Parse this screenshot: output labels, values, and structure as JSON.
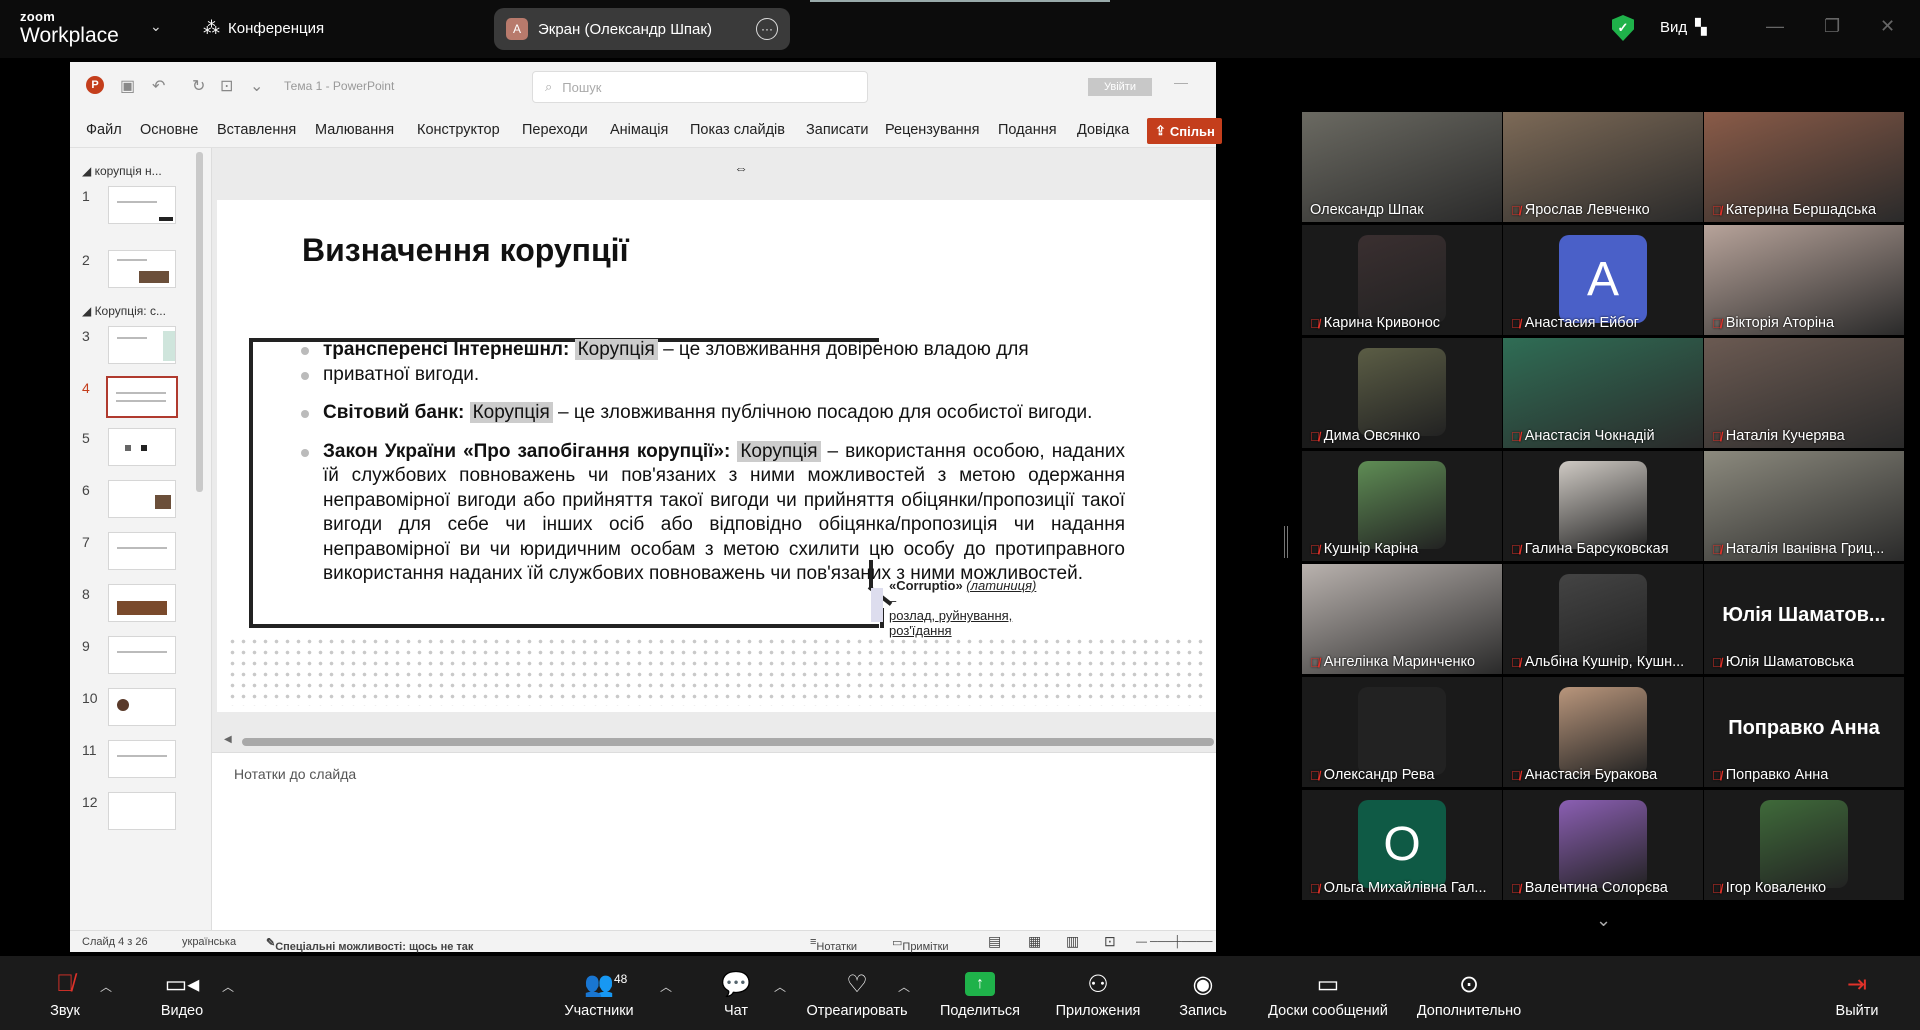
{
  "zoom": {
    "brand_top": "zoom",
    "brand_bottom": "Workplace",
    "meeting_label": "Конференция",
    "screen_share_label": "Экран (Олександр Шпак)",
    "screen_share_avatar": "A",
    "view_label": "Вид",
    "security_color": "#1fb24a"
  },
  "ppt": {
    "doc_title": "Тема 1 - PowerPoint",
    "search_placeholder": "Пошук",
    "signin_label": "Увійти",
    "tabs": [
      "Файл",
      "Основне",
      "Вставлення",
      "Малювання",
      "Конструктор",
      "Переходи",
      "Анімація",
      "Показ слайдів",
      "Записати",
      "Рецензування",
      "Подання",
      "Довідка"
    ],
    "share_label": "Спільн",
    "sections": [
      "корупція н...",
      "Корупція: с..."
    ],
    "slide_numbers": [
      "1",
      "2",
      "3",
      "4",
      "5",
      "6",
      "7",
      "8",
      "9",
      "10",
      "11",
      "12"
    ],
    "active_slide": "4",
    "notes_placeholder": "Нотатки до слайда",
    "status": {
      "slide_counter": "Слайд 4 з 26",
      "language": "українська",
      "accessibility": "Спеціальні можливості: щось не так",
      "notes": "Нотатки",
      "comments": "Примітки"
    },
    "accent": "#c43e1c"
  },
  "slide": {
    "title": "Визначення корупції",
    "b1_label": "трансперенсі Інтернешнл:",
    "b1_term": "Корупція",
    "b1_line1_rest": "– це зловживання довіреною владою для",
    "b1_line2": "приватної вигоди.",
    "b2_label": "Світовий банк:",
    "b2_term": "Корупція",
    "b2_rest": "– це зловживання публічною посадою для особистої вигоди.",
    "b3_label": "Закон України «Про запобігання корупції»:",
    "b3_term": "Корупція",
    "b3_rest": "– використання особою, наданих їй службових повноважень чи пов'язаних з ними можливостей з метою одержання неправомірної вигоди або прийняття такої вигоди чи прийняття обіцянки/пропозиції такої вигоди для себе чи інших осіб або відповідно обіцянка/пропозиція чи надання неправомірної ви чи юридичним особам з метою схилити цю особу до протиправного використання наданих їй службових повноважень чи пов'язаних з ними можливостей.",
    "callout_term": "«Corruptio»",
    "callout_lang": "(латиниця)",
    "callout_dash": "–",
    "callout_meaning": "розлад, руйнування, роз'їдання"
  },
  "participants": [
    {
      "name": "Олександр Шпак",
      "muted": false,
      "active": true,
      "kind": "video",
      "color": "#6b6a62"
    },
    {
      "name": "Ярослав Левченко",
      "muted": true,
      "kind": "video",
      "color": "#7d6a57"
    },
    {
      "name": "Катерина Бершадська",
      "muted": true,
      "kind": "video",
      "color": "#8a5b48"
    },
    {
      "name": "Карина Кривонос",
      "muted": true,
      "kind": "photo",
      "color": "#3a2f30"
    },
    {
      "name": "Анастасия Ейбог",
      "muted": true,
      "kind": "initial",
      "initial": "A",
      "color": "#4a60c8"
    },
    {
      "name": "Вікторія Аторіна",
      "muted": true,
      "kind": "video",
      "color": "#b7a39a"
    },
    {
      "name": "Дима Овсянко",
      "muted": true,
      "kind": "photo",
      "color": "#5b5d45"
    },
    {
      "name": "Анастасія Чокнадій",
      "muted": true,
      "kind": "video",
      "color": "#2f6d55"
    },
    {
      "name": "Наталія Кучерява",
      "muted": true,
      "kind": "video",
      "color": "#6b5a52"
    },
    {
      "name": "Кушнір Каріна",
      "muted": true,
      "kind": "photo",
      "color": "#5f8d55"
    },
    {
      "name": "Галина Барсуковская",
      "muted": true,
      "kind": "photo",
      "color": "#cfcac4"
    },
    {
      "name": "Наталія Іванівна Гриц...",
      "muted": true,
      "kind": "video",
      "color": "#8c8a7e"
    },
    {
      "name": "Ангелінка Маринченко",
      "muted": true,
      "kind": "video",
      "color": "#b9b2ae"
    },
    {
      "name": "Альбіна Кушнір, Кушн...",
      "muted": true,
      "kind": "photo",
      "color": "#444"
    },
    {
      "name": "Юлія Шаматовська",
      "muted": true,
      "kind": "text",
      "big": "Юлія Шаматов..."
    },
    {
      "name": "Олександр Рева",
      "muted": true,
      "kind": "photo",
      "color": "#222"
    },
    {
      "name": "Анастасія Буракова",
      "muted": true,
      "kind": "photo",
      "color": "#b9967c"
    },
    {
      "name": "Поправко Анна",
      "muted": true,
      "kind": "text",
      "big": "Поправко Анна"
    },
    {
      "name": "Ольга Михайлівна Гал...",
      "muted": true,
      "kind": "initial",
      "initial": "O",
      "color": "#0f5a45"
    },
    {
      "name": "Валентина Солорєва",
      "muted": true,
      "kind": "photo",
      "color": "#8b5fb3"
    },
    {
      "name": "Ігор Коваленко",
      "muted": true,
      "kind": "photo",
      "color": "#3f6a3a"
    }
  ],
  "toolbar": {
    "audio": "Звук",
    "video": "Видео",
    "participants": "Участники",
    "participants_count": "48",
    "chat": "Чат",
    "react": "Отреагировать",
    "share": "Поделиться",
    "apps": "Приложения",
    "record": "Запись",
    "whiteboards": "Доски сообщений",
    "more": "Дополнительно",
    "leave": "Выйти"
  }
}
